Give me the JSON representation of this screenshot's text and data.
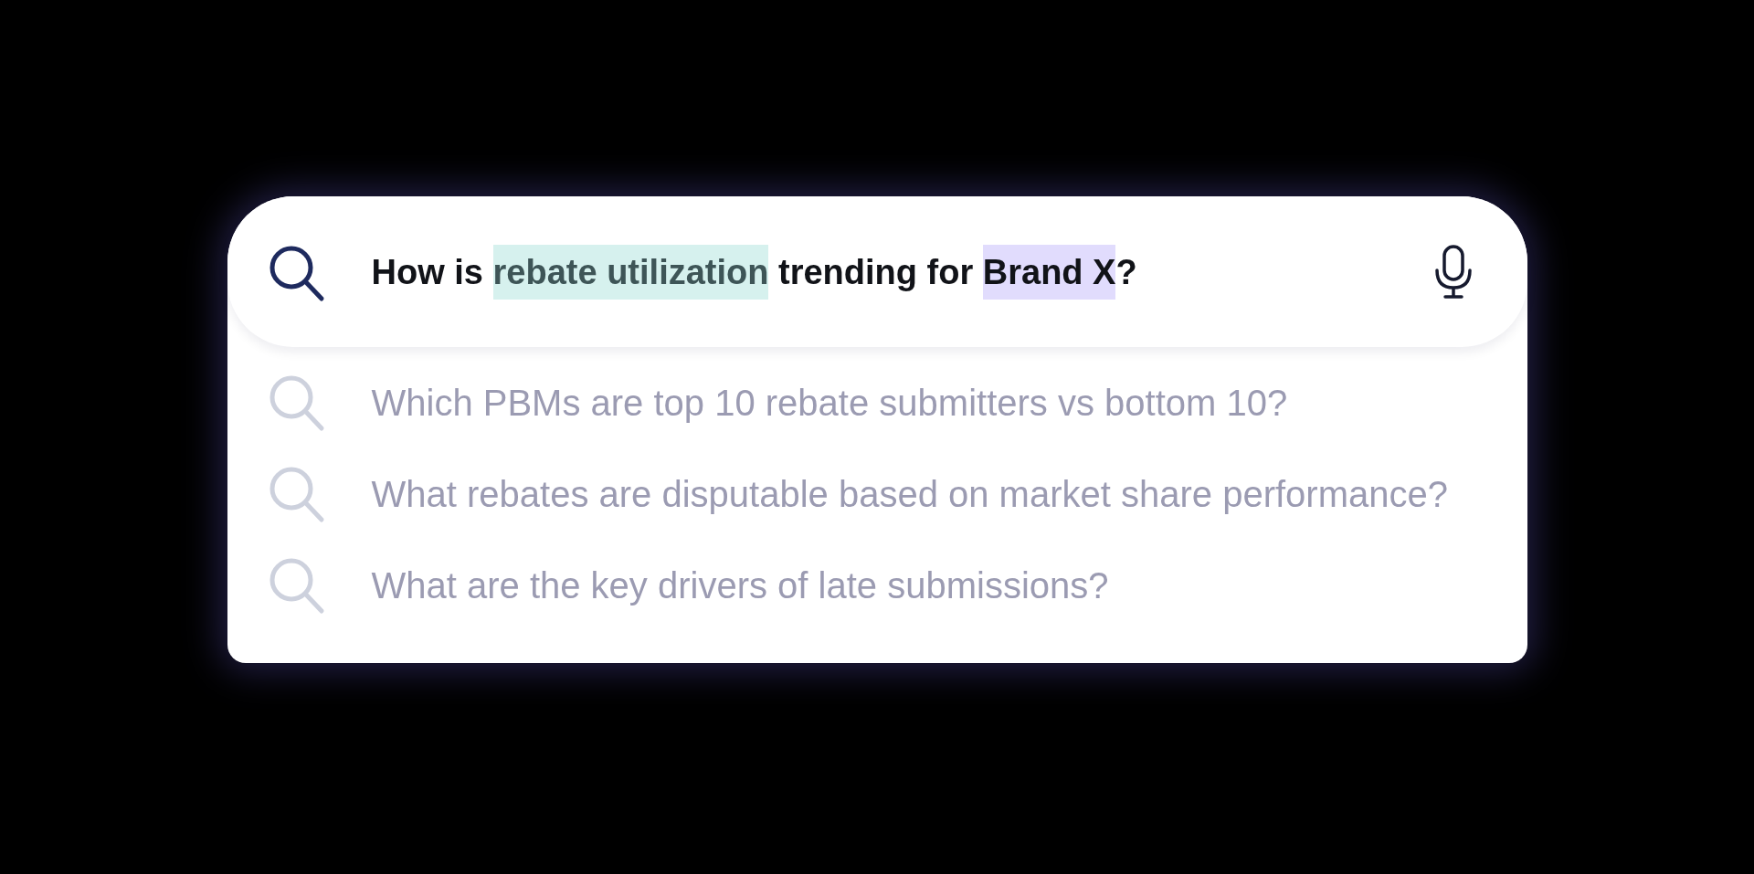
{
  "search": {
    "query": [
      {
        "kind": "plain",
        "text": "How is "
      },
      {
        "kind": "metric",
        "text": "rebate utilization",
        "color": "#d6f1ee"
      },
      {
        "kind": "plain",
        "text": " trending for "
      },
      {
        "kind": "entity",
        "text": "Brand X",
        "color": "#e1dcfd"
      },
      {
        "kind": "plain",
        "text": "?"
      }
    ]
  },
  "suggestions": [
    {
      "text": "Which PBMs are top 10 rebate submitters vs bottom 10?"
    },
    {
      "text": "What rebates are disputable based on market share performance?"
    },
    {
      "text": "What are the key drivers of late submissions?"
    }
  ]
}
